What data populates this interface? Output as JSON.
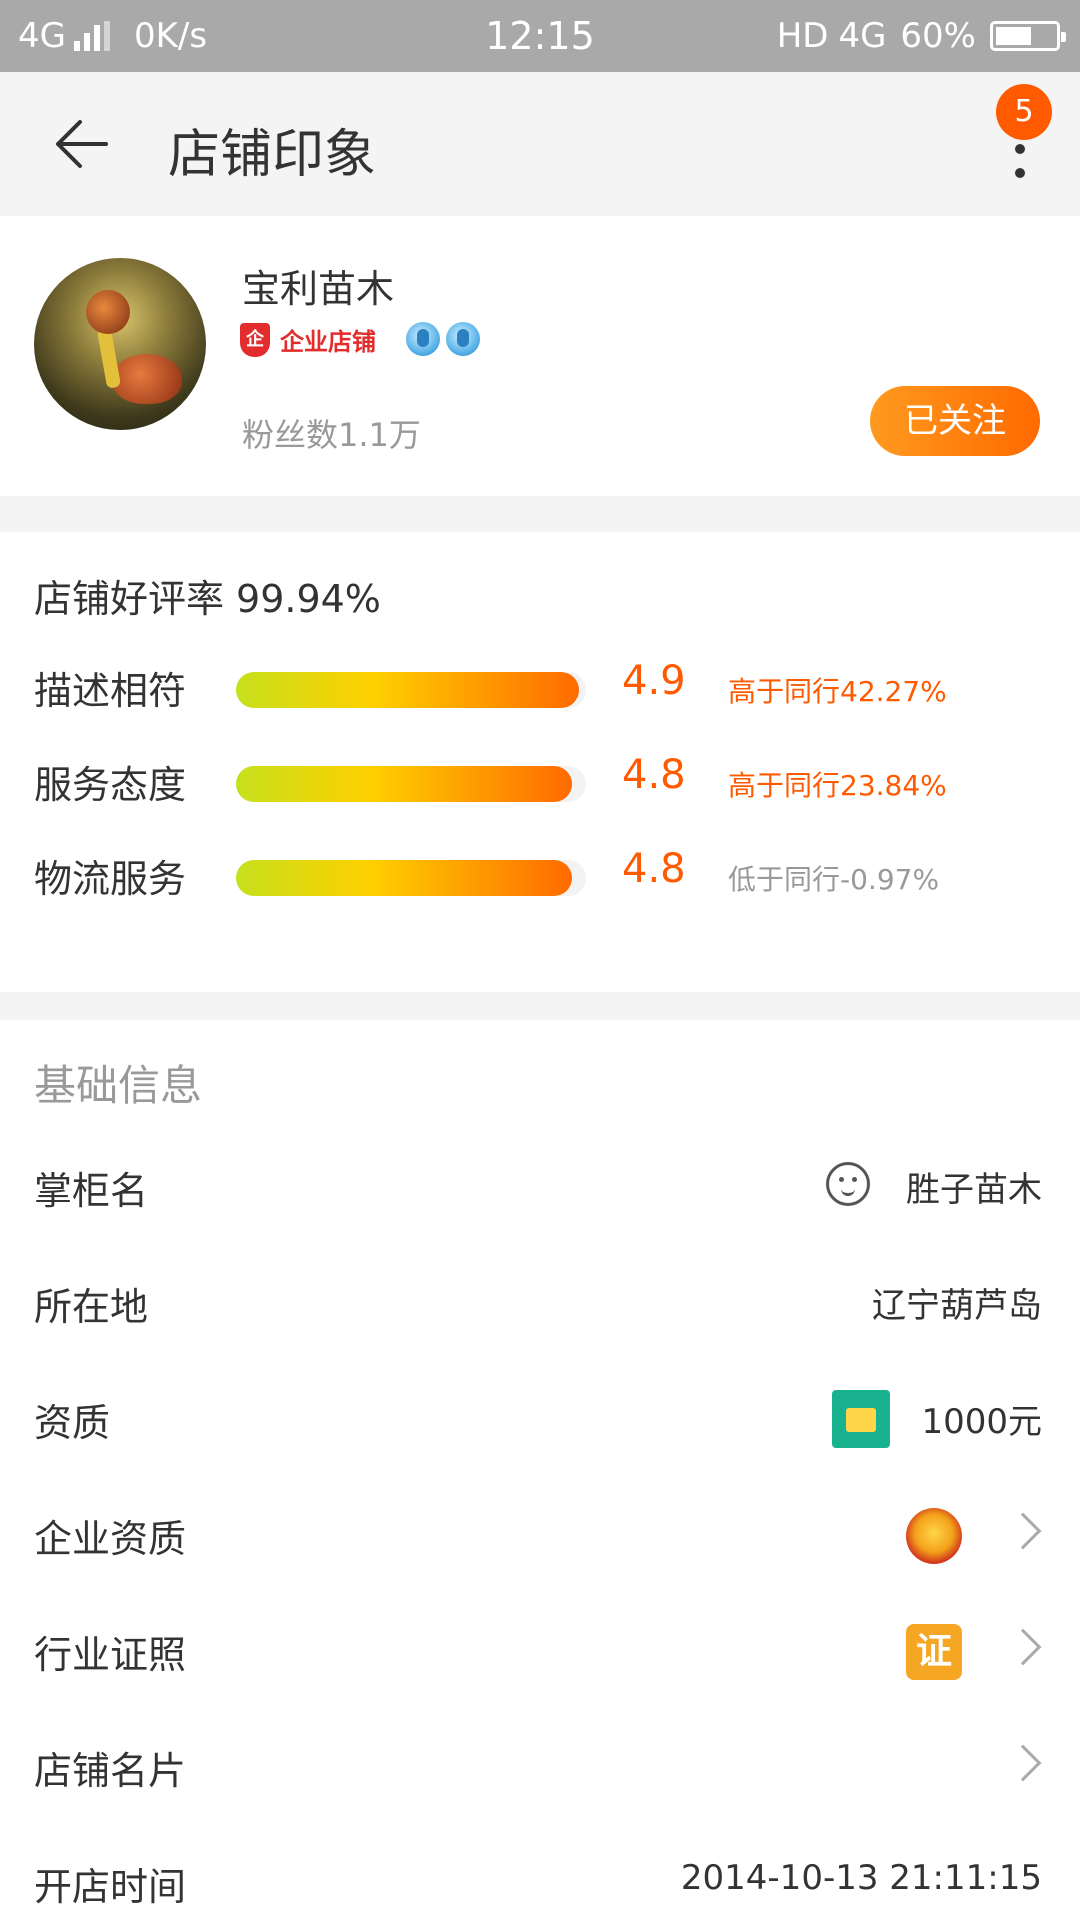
{
  "status_bar": {
    "network": "4G",
    "speed": "0K/s",
    "time": "12:15",
    "hd": "HD",
    "network_right": "4G",
    "battery": "60%",
    "battery_level": 0.6
  },
  "nav": {
    "title": "店铺印象",
    "more_badge": "5"
  },
  "store": {
    "name": "宝利苗木",
    "badge_shield": "企",
    "badge_label": "企业店铺",
    "fans": "粉丝数1.1万",
    "follow_button": "已关注"
  },
  "ratings": {
    "good_rate_label": "店铺好评率",
    "good_rate_value": "99.94%",
    "items": [
      {
        "label": "描述相符",
        "score": "4.9",
        "compare": "高于同行42.27%",
        "level": 0.98,
        "trend": "higher"
      },
      {
        "label": "服务态度",
        "score": "4.8",
        "compare": "高于同行23.84%",
        "level": 0.96,
        "trend": "higher"
      },
      {
        "label": "物流服务",
        "score": "4.8",
        "compare": "低于同行-0.97%",
        "level": 0.96,
        "trend": "lower"
      }
    ]
  },
  "basic_info": {
    "title": "基础信息",
    "rows": [
      {
        "label": "掌柜名",
        "value": "胜子苗木",
        "icon": "wangwang-icon"
      },
      {
        "label": "所在地",
        "value": "辽宁葫芦岛"
      },
      {
        "label": "资质",
        "value": "1000元",
        "icon": "deposit-icon"
      },
      {
        "label": "企业资质",
        "value": "",
        "icon": "national-emblem-icon"
      },
      {
        "label": "行业证照",
        "value": "",
        "icon": "certificate-icon",
        "icon_text": "证"
      },
      {
        "label": "店铺名片",
        "value": ""
      },
      {
        "label": "开店时间",
        "value": "2014-10-13 21:11:15"
      }
    ]
  },
  "colors": {
    "accent": "#ff5a00",
    "status_bar": "#a9a9a9",
    "enterprise_red": "#e32c2c"
  }
}
